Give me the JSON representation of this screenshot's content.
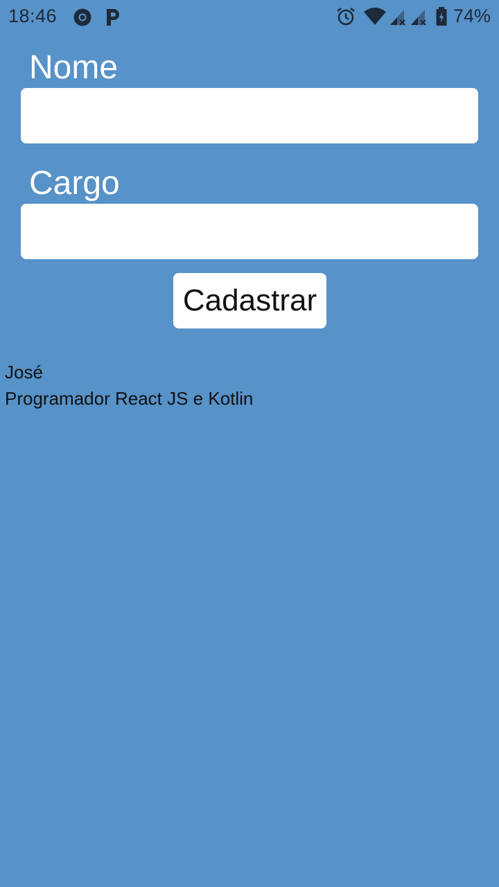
{
  "status_bar": {
    "time": "18:46",
    "battery": "74%",
    "icons": [
      "chrome-icon",
      "parking-icon",
      "alarm-icon",
      "wifi-icon",
      "signal-icon",
      "signal-icon",
      "battery-icon"
    ]
  },
  "form": {
    "name_label": "Nome",
    "name_value": "",
    "role_label": "Cargo",
    "role_value": "",
    "submit_label": "Cadastrar"
  },
  "entries": [
    {
      "name": "José",
      "role": "Programador React JS e Kotlin"
    }
  ],
  "colors": {
    "background": "#5792c8",
    "input_bg": "#ffffff",
    "text": "#111111"
  }
}
